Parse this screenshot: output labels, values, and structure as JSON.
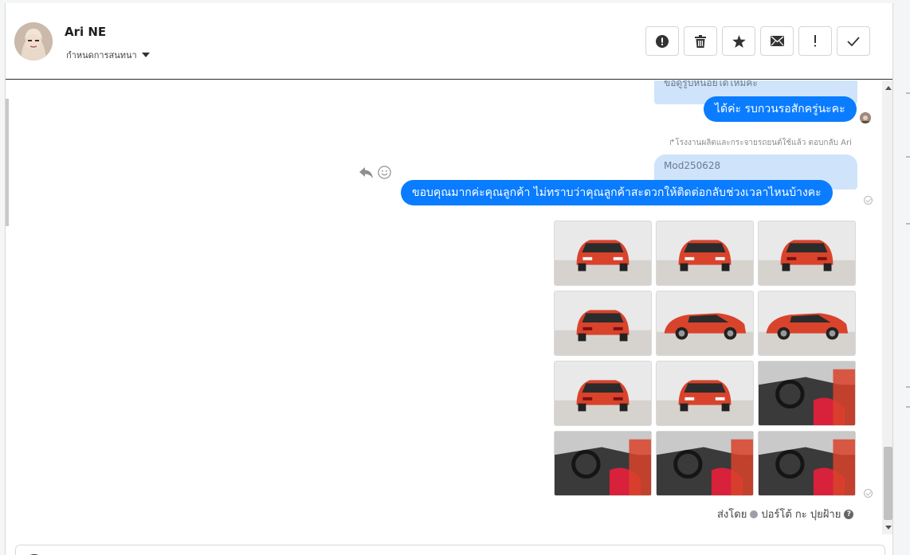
{
  "header": {
    "contact_name": "Ari NE",
    "conversation_setting": "กำหนดการสนทนา"
  },
  "toolbar": {
    "buttons": [
      {
        "name": "spam",
        "icon": "alert-circle-icon"
      },
      {
        "name": "delete",
        "icon": "trash-icon"
      },
      {
        "name": "star",
        "icon": "star-icon"
      },
      {
        "name": "mark-unread",
        "icon": "envelope-icon"
      },
      {
        "name": "important",
        "icon": "exclamation-icon"
      },
      {
        "name": "done",
        "icon": "check-icon"
      }
    ]
  },
  "messages": {
    "m1": {
      "quote_partial": "ขอดูรูปหน่อยได้ไหมคะ",
      "text": "ได้ค่ะ รบกวนรอสักครู่นะคะ"
    },
    "m2": {
      "reply_label": "โรงงานผลิตและกระจายรถยนต์ใช้แล้ว ตอบกลับ Ari",
      "quote": "Mod250628",
      "text": "ขอบคุณมากค่ะคุณลูกค้า ไม่ทราบว่าคุณลูกค้าสะดวกให้ติดต่อกลับช่วงเวลาไหนบ้างคะ"
    },
    "photo_grid": {
      "count": 12,
      "car_color": "#d9432c"
    },
    "sent_by": {
      "label": "ส่งโดย",
      "name": "ปอร์โต้ กะ ปุยฝ้าย"
    }
  },
  "colors": {
    "bubble": "#0a7cff",
    "reply_box": "#cfe4fb"
  }
}
